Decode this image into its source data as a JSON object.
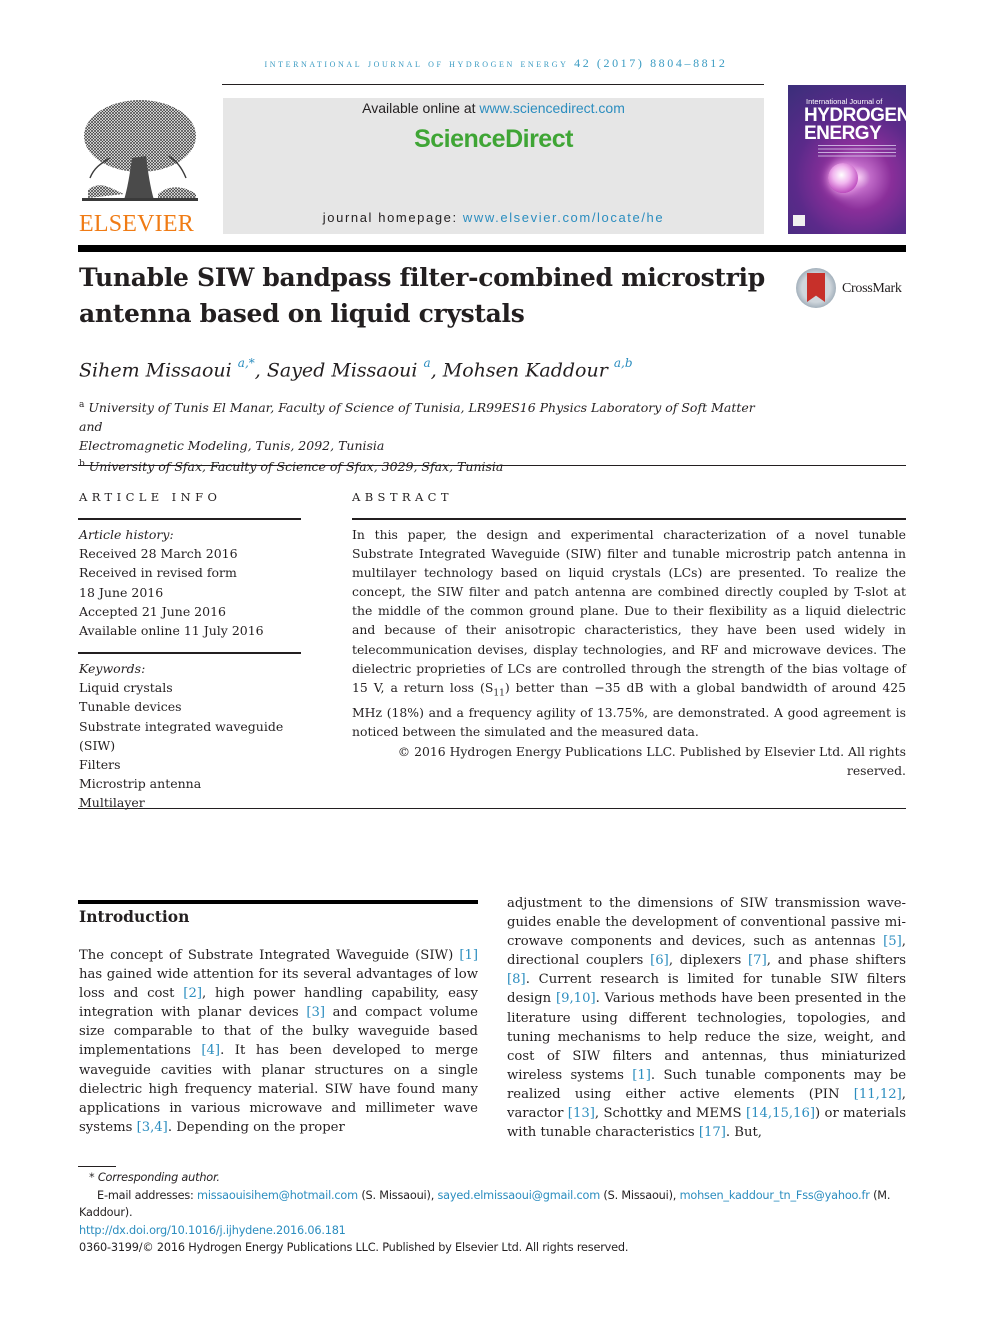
{
  "running_header": "International Journal of Hydrogen Energy 42 (2017) 8804–8812",
  "masthead": {
    "publisher_logo_text": "ELSEVIER",
    "available_online_prefix": "Available online at ",
    "available_online_link": "www.sciencedirect.com",
    "platform_name": "ScienceDirect",
    "homepage_prefix": "journal homepage: ",
    "homepage_link": "www.elsevier.com/locate/he",
    "cover": {
      "line1": "International Journal of",
      "line2": "HYDROGEN",
      "line3": "ENERGY"
    },
    "colors": {
      "elsevier_orange": "#f07b14",
      "sciencedirect_green": "#3fa535",
      "link_blue": "#2b8dbf"
    }
  },
  "article": {
    "title_line1": "Tunable SIW bandpass filter-combined microstrip",
    "title_line2": "antenna based on liquid crystals",
    "crossmark_label": "CrossMark",
    "authors": [
      {
        "name": "Sihem Missaoui",
        "sup": "a,*",
        "sep": ", "
      },
      {
        "name": "Sayed Missaoui",
        "sup": "a",
        "sep": ", "
      },
      {
        "name": "Mohsen Kaddour",
        "sup": "a,b",
        "sep": ""
      }
    ],
    "affiliations": [
      {
        "mark": "a",
        "text_line1": "University of Tunis El Manar, Faculty of Science of Tunisia, LR99ES16 Physics Laboratory of Soft Matter and",
        "text_line2": "Electromagnetic Modeling, Tunis, 2092, Tunisia"
      },
      {
        "mark": "b",
        "text_line1": "University of Sfax, Faculty of Science of Sfax, 3029, Sfax, Tunisia"
      }
    ]
  },
  "article_info": {
    "heading": "ARTICLE INFO",
    "history_label": "Article history:",
    "history": [
      "Received 28 March 2016",
      "Received in revised form",
      "18 June 2016",
      "Accepted 21 June 2016",
      "Available online 11 July 2016"
    ],
    "keywords_label": "Keywords:",
    "keywords": [
      "Liquid crystals",
      "Tunable devices",
      "Substrate integrated waveguide (SIW)",
      "Filters",
      "Microstrip antenna",
      "Multilayer"
    ]
  },
  "abstract": {
    "heading": "ABSTRACT",
    "text_before_sub": "In this paper, the design and experimental characterization of a novel tunable Substrate Integrated Waveguide (SIW) filter and tunable microstrip patch antenna in multilayer technology based on liquid crystals (LCs) are presented. To realize the concept, the SIW filter and patch antenna are combined directly coupled by T-slot at the middle of the common ground plane. Due to their flexibility as a liquid dielectric and because of their anisotropic characteristics, they have been used widely in telecommunication devises, display technologies, and RF and microwave devices. The dielectric proprieties of LCs are controlled through the strength of the bias voltage of 15 V, a return loss (S",
    "subscript": "11",
    "text_after_sub": ") better than −35 dB with a global bandwidth of around 425 MHz (18%) and a frequency agility of 13.75%, are demonstrated. A good agreement is noticed between the simulated and the measured data.",
    "copyright": "© 2016 Hydrogen Energy Publications LLC. Published by Elsevier Ltd. All rights reserved."
  },
  "introduction": {
    "heading": "Introduction",
    "left_column": [
      {
        "t": "The concept of Substrate Integrated Waveguide (SIW) "
      },
      {
        "ref": "[1]"
      },
      {
        "t": " has gained wide attention for its several advantages of low loss and cost "
      },
      {
        "ref": "[2]"
      },
      {
        "t": ", high power handling capability, easy integration with planar devices "
      },
      {
        "ref": "[3]"
      },
      {
        "t": " and compact volume size comparable to that of the bulky waveguide based implementations "
      },
      {
        "ref": "[4]"
      },
      {
        "t": ". It has been developed to merge waveguide cavities with planar structures on a single dielectric high frequency material. SIW have found many applications in various microwave and millimeter wave systems "
      },
      {
        "ref": "[3,4]"
      },
      {
        "t": ". Depending on the proper"
      }
    ],
    "right_column": [
      {
        "t": "adjustment to the dimensions of SIW transmission wave­guides enable the development of conventional passive mi­crowave components and devices, such as antennas "
      },
      {
        "ref": "[5]"
      },
      {
        "t": ", directional couplers "
      },
      {
        "ref": "[6]"
      },
      {
        "t": ", diplexers "
      },
      {
        "ref": "[7]"
      },
      {
        "t": ", and phase shifters "
      },
      {
        "ref": "[8]"
      },
      {
        "t": ". Current research is limited for tunable SIW filters design "
      },
      {
        "ref": "[9,10]"
      },
      {
        "t": ". Various methods have been presented in the literature using different technologies, topologies, and tuning mecha­nisms to help reduce the size, weight, and cost of SIW filters and antennas, thus miniaturized wireless systems "
      },
      {
        "ref": "[1]"
      },
      {
        "t": ". Such tunable components may be realized using either active ele­ments (PIN "
      },
      {
        "ref": "[11,12]"
      },
      {
        "t": ", varactor "
      },
      {
        "ref": "[13]"
      },
      {
        "t": ", Schottky and MEMS "
      },
      {
        "ref": "[14,15,16]"
      },
      {
        "t": ") or materials with tunable characteristics "
      },
      {
        "ref": "[17]"
      },
      {
        "t": ". But,"
      }
    ]
  },
  "footnotes": {
    "corresponding": "* Corresponding author.",
    "email_label": "E-mail addresses: ",
    "emails": [
      {
        "address": "missaouisihem@hotmail.com",
        "who": " (S. Missaoui), "
      },
      {
        "address": "sayed.elmissaoui@gmail.com",
        "who": " (S. Missaoui), "
      },
      {
        "address": "mohsen_kaddour_tn_Fss@yahoo.fr",
        "who": " (M. Kaddour)."
      }
    ],
    "doi": "http://dx.doi.org/10.1016/j.ijhydene.2016.06.181",
    "issn_copyright": "0360-3199/© 2016 Hydrogen Energy Publications LLC. Published by Elsevier Ltd. All rights reserved."
  }
}
